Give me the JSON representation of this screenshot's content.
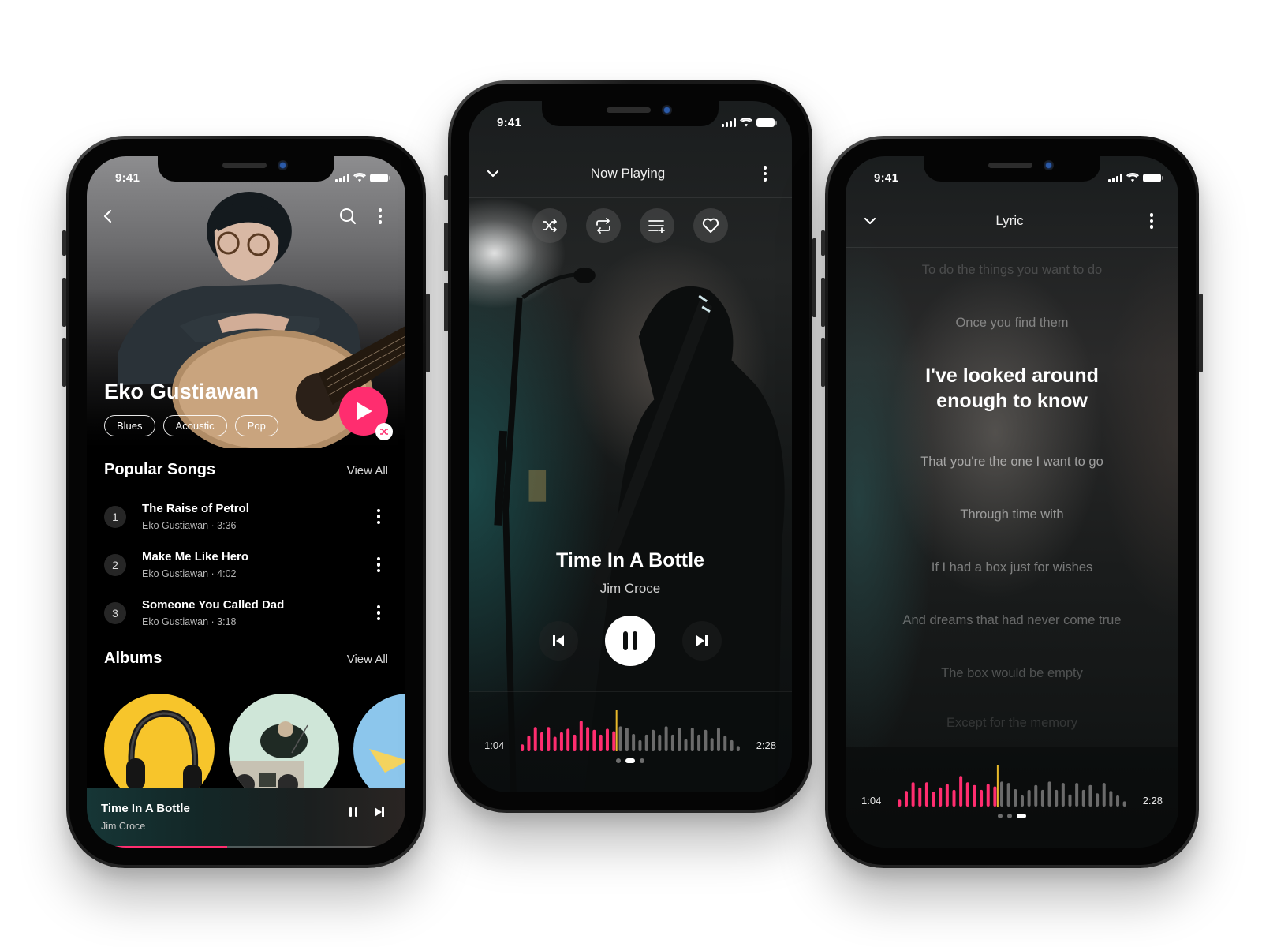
{
  "colors": {
    "accent": "#ff2d6f",
    "playhead": "#e8b92a",
    "wave_unplayed": "#6b6b6b"
  },
  "status_bar": {
    "time": "9:41"
  },
  "artist_screen": {
    "artist_name": "Eko Gustiawan",
    "genres": [
      "Blues",
      "Acoustic",
      "Pop"
    ],
    "popular_songs": {
      "title": "Popular Songs",
      "view_all": "View All",
      "songs": [
        {
          "number": "1",
          "title": "The Raise of Petrol",
          "meta": "Eko Gustiawan · 3:36"
        },
        {
          "number": "2",
          "title": "Make Me Like Hero",
          "meta": "Eko Gustiawan · 4:02"
        },
        {
          "number": "3",
          "title": "Someone You Called Dad",
          "meta": "Eko Gustiawan · 3:18"
        }
      ]
    },
    "albums": {
      "title": "Albums",
      "view_all": "View All",
      "items": [
        {
          "art": "yellow-headphones"
        },
        {
          "art": "boombox"
        },
        {
          "art": "paper-plane"
        }
      ]
    },
    "mini_player": {
      "title": "Time In A Bottle",
      "artist": "Jim Croce",
      "progress": 0.44
    }
  },
  "now_playing_screen": {
    "header_title": "Now Playing",
    "actions": [
      "shuffle-icon",
      "repeat-icon",
      "add-to-queue-icon",
      "heart-icon"
    ],
    "song_title": "Time In A Bottle",
    "artist": "Jim Croce",
    "elapsed": "1:04",
    "duration": "2:28",
    "page_dots": 3,
    "active_page": 1
  },
  "lyric_screen": {
    "header_title": "Lyric",
    "lines": [
      {
        "text": "To do the things you want to do",
        "opacity": 0.18
      },
      {
        "text": "Once you find them",
        "opacity": 0.4
      },
      {
        "text": "I've looked around enough to know",
        "current": true,
        "opacity": 1
      },
      {
        "text": "That you're the one I want to go",
        "opacity": 0.55
      },
      {
        "text": "Through time with",
        "opacity": 0.5
      },
      {
        "text": "If I had a box just for wishes",
        "opacity": 0.42
      },
      {
        "text": "And dreams that had never come true",
        "opacity": 0.35
      },
      {
        "text": "The box would be empty",
        "opacity": 0.25
      },
      {
        "text": "Except for the memory",
        "opacity": 0.14
      }
    ],
    "elapsed": "1:04",
    "duration": "2:28",
    "page_dots": 3,
    "active_page": 2
  },
  "waveform": {
    "played_fraction": 0.435,
    "bars": [
      0.2,
      0.45,
      0.7,
      0.55,
      0.7,
      0.42,
      0.55,
      0.65,
      0.48,
      0.88,
      0.7,
      0.62,
      0.48,
      0.65,
      0.58,
      0.72,
      0.68,
      0.5,
      0.32,
      0.48,
      0.62,
      0.48,
      0.72,
      0.48,
      0.68,
      0.35,
      0.68,
      0.48,
      0.62,
      0.38,
      0.68,
      0.45,
      0.32,
      0.15
    ]
  }
}
